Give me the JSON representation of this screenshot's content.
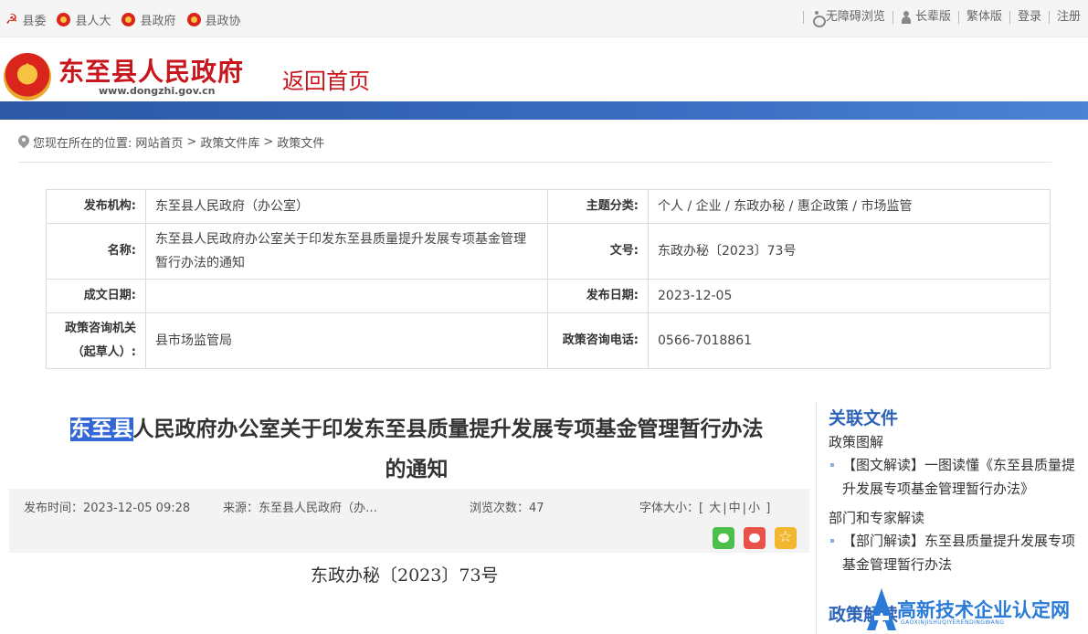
{
  "topbar": {
    "left_links": [
      {
        "label": "县委",
        "icon": "party-icon"
      },
      {
        "label": "县人大",
        "icon": "emblem-icon"
      },
      {
        "label": "县政府",
        "icon": "emblem-icon"
      },
      {
        "label": "县政协",
        "icon": "cppcc-icon"
      }
    ],
    "right_links": [
      "无障碍浏览",
      "长辈版",
      "繁体版",
      "登录",
      "注册"
    ]
  },
  "header": {
    "site_title": "东至县人民政府",
    "site_url": "www.dongzhi.gov.cn",
    "back_home": "返回首页"
  },
  "breadcrumb": {
    "prefix": "您现在所在的位置:",
    "items": [
      "网站首页",
      "政策文件库",
      "政策文件"
    ],
    "separator": ">"
  },
  "info_table": {
    "publisher_label": "发布机构:",
    "publisher": "东至县人民政府（办公室）",
    "topic_label": "主题分类:",
    "topic": "个人 / 企业 / 东政办秘 / 惠企政策 / 市场监管",
    "name_label": "名称:",
    "name": "东至县人民政府办公室关于印发东至县质量提升发展专项基金管理暂行办法的通知",
    "docno_label": "文号:",
    "docno": "东政办秘〔2023〕73号",
    "written_label": "成文日期:",
    "written": "",
    "pubdate_label": "发布日期:",
    "pubdate": "2023-12-05",
    "consult_label": "政策咨询机关（起草人）:",
    "consult": "县市场监管局",
    "phone_label": "政策咨询电话:",
    "phone": "0566-7018861"
  },
  "article": {
    "title_highlight": "东至县",
    "title_rest": "人民政府办公室关于印发东至县质量提升发展专项基金管理暂行办法的通知",
    "pub_time": "发布时间：2023-12-05 09:28",
    "source": "来源：东至县人民政府（办…",
    "views": "浏览次数：47",
    "font_size_label": "字体大小：[",
    "font_large": "大",
    "font_medium": "中",
    "font_small": "小",
    "font_sep": "|",
    "font_close": "]",
    "doc_number": "东政办秘〔2023〕73号"
  },
  "sidebar": {
    "heading": "关联文件",
    "sections": [
      {
        "category": "政策图解",
        "items": [
          "【图文解读】一图读懂《东至县质量提升发展专项基金管理暂行办法》"
        ]
      },
      {
        "category": "部门和专家解读",
        "items": [
          "【部门解读】东至县质量提升发展专项基金管理暂行办法"
        ]
      }
    ],
    "heading2": "政策解读"
  },
  "watermark": {
    "text": "高新技术企业认定网",
    "sub": "GAOXINJISHUQIYERENDINGWANG"
  },
  "colors": {
    "brand_red": "#c8161d",
    "nav_blue": "#2c58a4",
    "link_blue": "#2d63b7"
  }
}
